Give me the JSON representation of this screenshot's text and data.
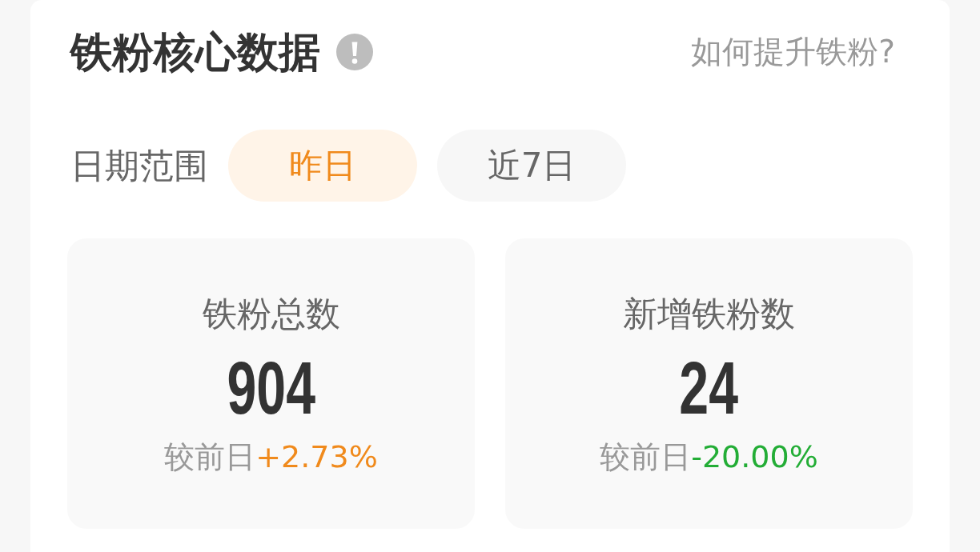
{
  "header": {
    "title": "铁粉核心数据",
    "help_link": "如何提升铁粉?"
  },
  "date_range": {
    "label": "日期范围",
    "options": [
      {
        "label": "昨日",
        "selected": true
      },
      {
        "label": "近7日",
        "selected": false
      }
    ]
  },
  "stats": [
    {
      "label": "铁粉总数",
      "value": "904",
      "comparison_label": "较前日",
      "change": "+2.73%",
      "color": "#f08a1c"
    },
    {
      "label": "新增铁粉数",
      "value": "24",
      "comparison_label": "较前日",
      "change": "-20.00%",
      "color": "#23ad36"
    }
  ]
}
